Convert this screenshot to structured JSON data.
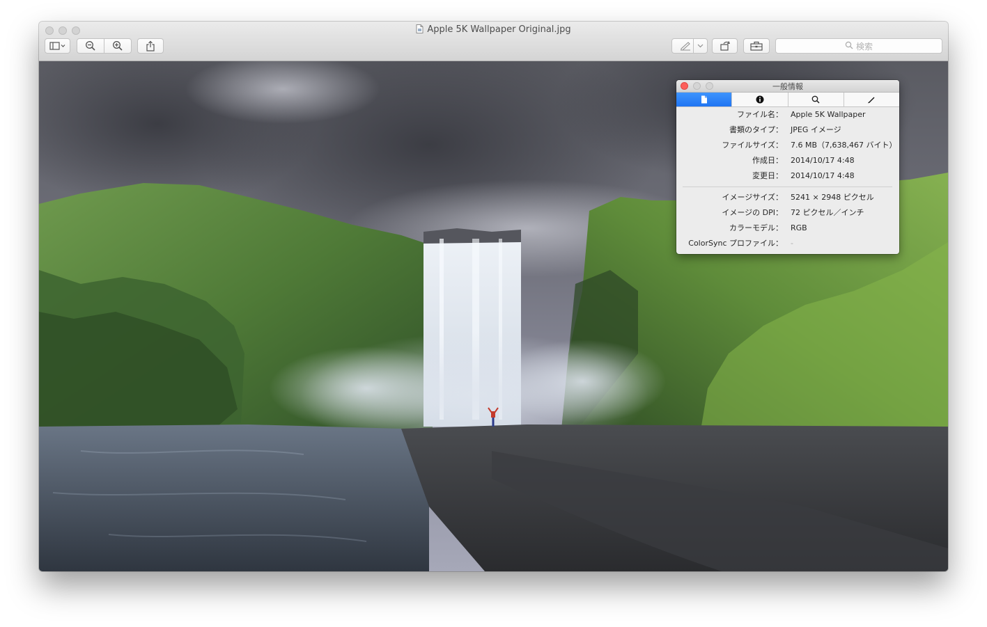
{
  "window": {
    "title": "Apple 5K Wallpaper Original.jpg"
  },
  "toolbar": {
    "sidebar_icon": "sidebar-icon",
    "zoom_out_icon": "zoom-out-icon",
    "zoom_in_icon": "zoom-in-icon",
    "share_icon": "share-icon",
    "markup_icon": "pen-icon",
    "rotate_icon": "rotate-icon",
    "toolbox_icon": "toolbox-icon",
    "search_placeholder": "検索"
  },
  "inspector": {
    "title": "一般情報",
    "tabs": [
      {
        "icon": "document-icon",
        "active": true
      },
      {
        "icon": "info-icon",
        "active": false
      },
      {
        "icon": "magnifier-icon",
        "active": false
      },
      {
        "icon": "pencil-icon",
        "active": false
      }
    ],
    "general": [
      {
        "label": "ファイル名：",
        "value": "Apple 5K Wallpaper"
      },
      {
        "label": "書類のタイプ：",
        "value": "JPEG イメージ"
      },
      {
        "label": "ファイルサイズ：",
        "value": "7.6 MB（7,638,467 バイト）"
      },
      {
        "label": "作成日：",
        "value": "2014/10/17 4:48"
      },
      {
        "label": "変更日：",
        "value": "2014/10/17 4:48"
      }
    ],
    "image": [
      {
        "label": "イメージサイズ：",
        "value": "5241 × 2948 ピクセル"
      },
      {
        "label": "イメージの DPI：",
        "value": "72 ピクセル／インチ"
      },
      {
        "label": "カラーモデル：",
        "value": "RGB"
      },
      {
        "label": "ColorSync プロファイル：",
        "value": "-"
      }
    ]
  },
  "colors": {
    "accent": "#1f74f2",
    "close_button": "#fc605c"
  }
}
